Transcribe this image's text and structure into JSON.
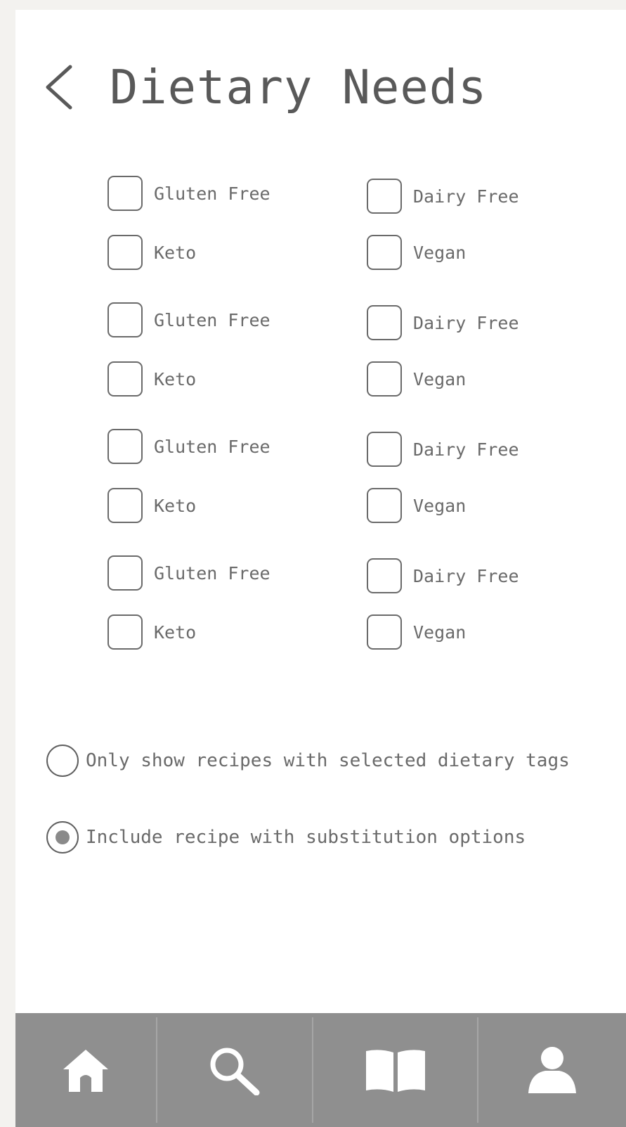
{
  "header": {
    "back_icon": "chevron-left-icon",
    "title": "Dietary Needs"
  },
  "dietary_options": [
    {
      "label": "Gluten Free",
      "checked": false
    },
    {
      "label": "Dairy Free",
      "checked": false
    },
    {
      "label": "Keto",
      "checked": false
    },
    {
      "label": "Vegan",
      "checked": false
    },
    {
      "label": "Gluten Free",
      "checked": false
    },
    {
      "label": "Dairy Free",
      "checked": false
    },
    {
      "label": "Keto",
      "checked": false
    },
    {
      "label": "Vegan",
      "checked": false
    },
    {
      "label": "Gluten Free",
      "checked": false
    },
    {
      "label": "Dairy Free",
      "checked": false
    },
    {
      "label": "Keto",
      "checked": false
    },
    {
      "label": "Vegan",
      "checked": false
    },
    {
      "label": "Gluten Free",
      "checked": false
    },
    {
      "label": "Dairy Free",
      "checked": false
    },
    {
      "label": "Keto",
      "checked": false
    },
    {
      "label": "Vegan",
      "checked": false
    }
  ],
  "filter_mode": {
    "options": [
      {
        "label": "Only show recipes with selected dietary tags",
        "selected": false
      },
      {
        "label": "Include recipe with substitution options",
        "selected": true
      }
    ]
  },
  "tab_bar": {
    "tabs": [
      {
        "icon": "home-icon"
      },
      {
        "icon": "search-icon"
      },
      {
        "icon": "book-icon"
      },
      {
        "icon": "user-icon"
      }
    ]
  },
  "colors": {
    "tab_bar_background": "#8f8f8f",
    "tab_icon": "#ffffff",
    "page_background": "#ffffff",
    "text": "#5f5f5f"
  }
}
